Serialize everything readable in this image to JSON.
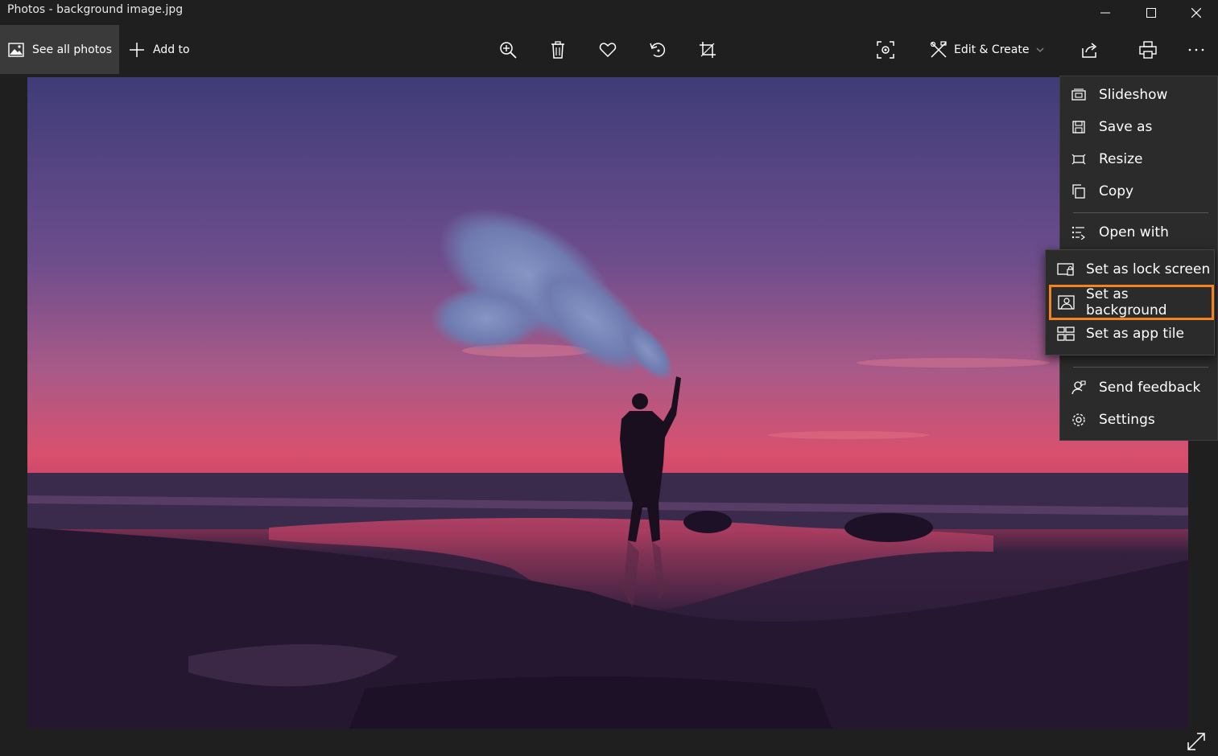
{
  "window": {
    "title": "Photos - background image.jpg"
  },
  "toolbar": {
    "see_all_photos": "See all photos",
    "add_to": "Add to",
    "edit_create": "Edit & Create"
  },
  "menu": {
    "items": [
      {
        "label": "Slideshow",
        "icon": "slideshow-icon"
      },
      {
        "label": "Save as",
        "icon": "save-icon"
      },
      {
        "label": "Resize",
        "icon": "resize-icon"
      },
      {
        "label": "Copy",
        "icon": "copy-icon"
      },
      {
        "label": "Open with",
        "icon": "open-with-icon"
      },
      {
        "label": "Send feedback",
        "icon": "feedback-icon"
      },
      {
        "label": "Settings",
        "icon": "gear-icon"
      }
    ]
  },
  "submenu": {
    "items": [
      {
        "label": "Set as lock screen",
        "icon": "lock-screen-icon"
      },
      {
        "label": "Set as background",
        "icon": "background-icon",
        "highlighted": true
      },
      {
        "label": "Set as app tile",
        "icon": "app-tile-icon"
      }
    ]
  },
  "colors": {
    "highlight": "#f5821f",
    "menu_bg": "#2b2b2b",
    "app_bg": "#1f1f1f"
  }
}
